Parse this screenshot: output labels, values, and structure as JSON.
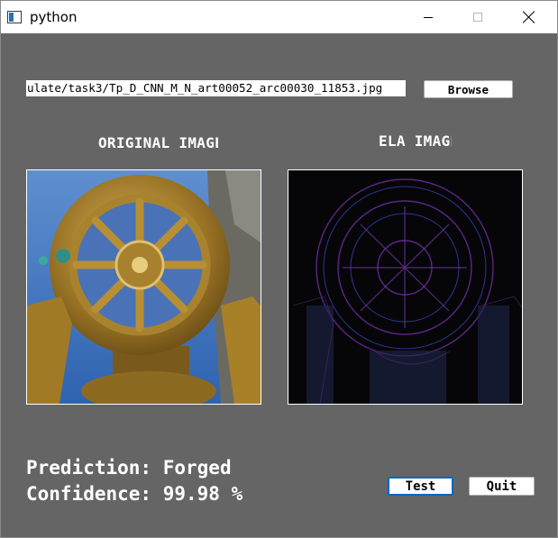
{
  "window": {
    "title": "python",
    "controls": [
      "minimize-icon",
      "maximize-icon",
      "close-icon"
    ]
  },
  "file": {
    "path_value": "ulate/task3/Tp_D_CNN_M_N_art00052_arc00030_11853.jpg",
    "browse_label": "Browse"
  },
  "images": {
    "original_title": "ORIGINAL IMAGE",
    "ela_title": "ELA IMAGE"
  },
  "result": {
    "prediction_label": "Prediction:",
    "prediction_value": "Forged",
    "confidence_label": "Confidence:",
    "confidence_value": "99.98 %"
  },
  "buttons": {
    "test_label": "Test",
    "quit_label": "Quit"
  },
  "colors": {
    "client_bg": "#656565",
    "text": "#ffffff",
    "focus_border": "#0067c0"
  }
}
